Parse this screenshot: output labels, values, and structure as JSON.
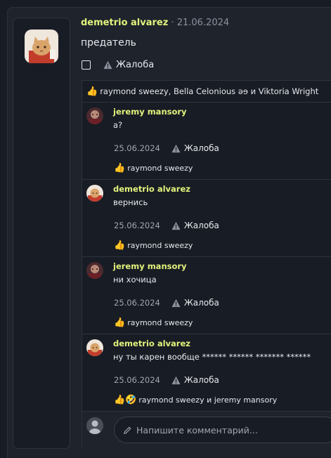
{
  "post": {
    "author": "demetrio alvarez",
    "date": "21.06.2024",
    "date_sep": " · ",
    "text": "предатель",
    "report_label": "Жалоба",
    "reactions": "raymond sweezy, Bella Celonious əɘ и Viktoria Wright",
    "reaction_emoji": "👍"
  },
  "comments": [
    {
      "author": "jeremy mansory",
      "text": "а?",
      "date": "25.06.2024",
      "report": "Жалоба",
      "emoji": "👍",
      "reactors": "raymond sweezy"
    },
    {
      "author": "demetrio alvarez",
      "text": "вернись",
      "date": "25.06.2024",
      "report": "Жалоба",
      "emoji": "👍",
      "reactors": "raymond sweezy"
    },
    {
      "author": "jeremy mansory",
      "text": "ни хочица",
      "date": "25.06.2024",
      "report": "Жалоба",
      "emoji": "👍",
      "reactors": "raymond sweezy"
    },
    {
      "author": "demetrio alvarez",
      "text": "ну ты карен вообще ****** ****** ******* ******",
      "date": "25.06.2024",
      "report": "Жалоба",
      "emoji": "👍🤣",
      "reactors": "raymond sweezy и jeremy mansory"
    }
  ],
  "comment_input": {
    "placeholder": "Напишите комментарий..."
  },
  "colors": {
    "accent_name": "#e2f27c",
    "background": "#181c24",
    "card": "#1e232c"
  },
  "icons": {
    "report": "warning-triangle-icon",
    "compose": "pencil-icon"
  }
}
